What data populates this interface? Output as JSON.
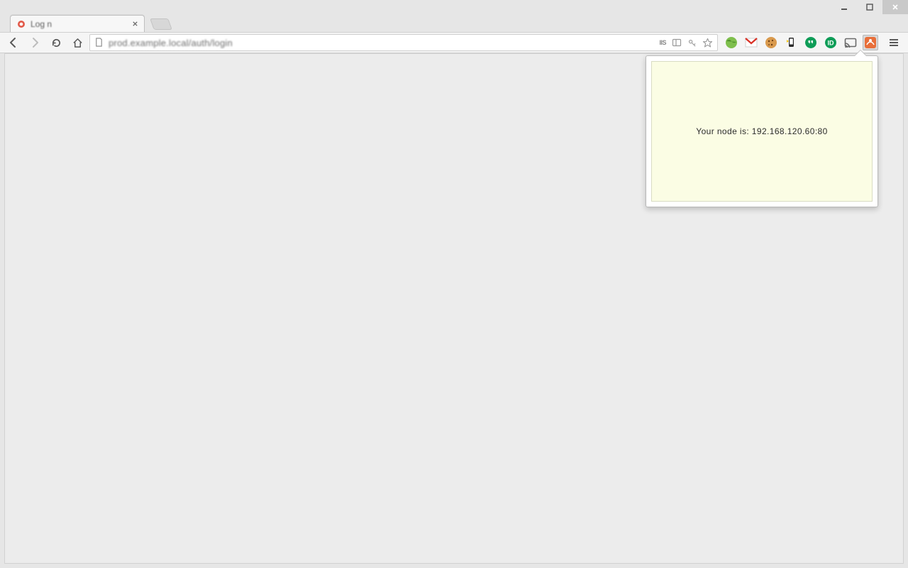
{
  "window": {
    "minimize_tip": "Minimize",
    "maximize_tip": "Maximize",
    "close_tip": "Close"
  },
  "tab": {
    "title": "Log n"
  },
  "toolbar": {
    "url_display": "prod.example.local/auth/login",
    "extensions": {
      "iis": "IIS",
      "gmail": "M"
    }
  },
  "popup": {
    "message": "Your node is: 192.168.120.60:80"
  }
}
